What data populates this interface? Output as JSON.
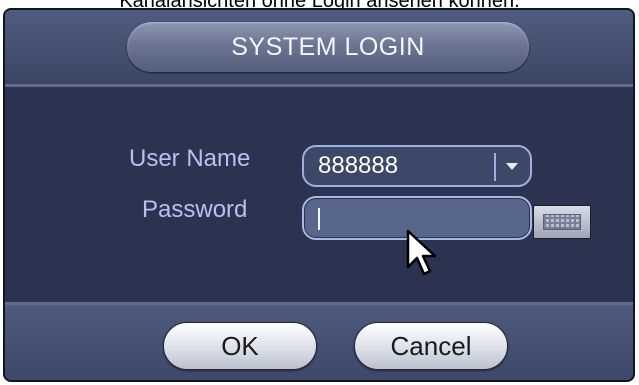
{
  "caption": "Kanalansichten ohne Login ansehen können.",
  "dialog": {
    "title": "SYSTEM LOGIN",
    "user_name_label": "User Name",
    "user_name_value": "888888",
    "password_label": "Password",
    "password_value": "",
    "ok_label": "OK",
    "cancel_label": "Cancel"
  },
  "icons": {
    "dropdown": "chevron-down-icon",
    "keyboard": "keyboard-icon",
    "cursor": "mouse-cursor-icon"
  },
  "colors": {
    "dialog_bg": "#2c3351",
    "label": "#b3c2ef",
    "field_border": "#9fb0e0"
  }
}
